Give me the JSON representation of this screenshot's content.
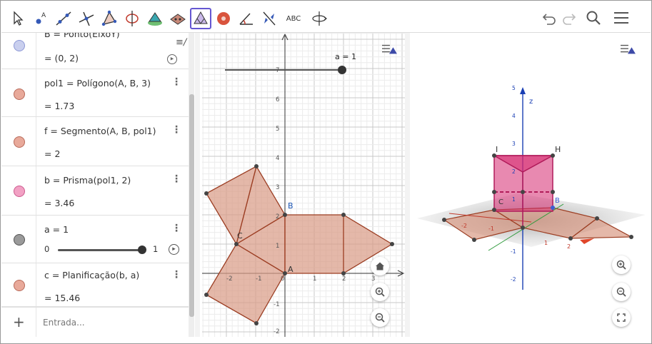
{
  "algebra": {
    "items": [
      {
        "def": "B = Ponto(EixoY)",
        "value": "= (0, 2)",
        "color": "#c9cfee",
        "border": "#8d98d6"
      },
      {
        "def": "pol1 = Polígono(A, B, 3)",
        "value": "= 1.73",
        "color": "#e8a99a",
        "border": "#b86a5a"
      },
      {
        "def": "f = Segmento(A, B, pol1)",
        "value": "= 2",
        "color": "#e8a99a",
        "border": "#b86a5a"
      },
      {
        "def": "b = Prisma(pol1, 2)",
        "value": "= 3.46",
        "color": "#f2a1c4",
        "border": "#cc5b8f"
      },
      {
        "def": "a = 1",
        "slider_min": "0",
        "slider_max": "1",
        "slider_level": 1.0,
        "color": "#9a9a9a",
        "border": "#555"
      },
      {
        "def": "c = Planificação(b, a)",
        "value": "= 15.46",
        "color": "#e8a99a",
        "border": "#b86a5a"
      }
    ],
    "input_placeholder": "Entrada..."
  },
  "graphics2d": {
    "slider_label": "a = 1",
    "slider_level": 1.0,
    "x_ticks": [
      "-2",
      "-1",
      "0",
      "1",
      "2",
      "3"
    ],
    "y_ticks": [
      "7",
      "6",
      "5",
      "4",
      "3",
      "2",
      "1",
      "-1",
      "-2"
    ],
    "point_labels": [
      "A",
      "B",
      "C"
    ]
  },
  "graphics3d": {
    "z_ticks": [
      "5",
      "4",
      "3",
      "2",
      "1",
      "-1",
      "-2"
    ],
    "axis_label": "z",
    "point_labels": [
      "I",
      "H",
      "B",
      "C"
    ],
    "plane_ticks": [
      "-2",
      "-1",
      "1",
      "2"
    ]
  },
  "colors": {
    "accent": "#6557d2",
    "polygon_fill": "#d99a84",
    "polygon_stroke": "#9b3d22",
    "prism": "#d6286f",
    "point": "#444444"
  },
  "icons": [
    "move-icon",
    "point-icon",
    "line-icon",
    "perpendicular-icon",
    "polygon-icon",
    "circle-axis-icon",
    "pyramid-icon",
    "intersect-icon",
    "net-icon",
    "sphere-icon",
    "angle-icon",
    "reflect-icon",
    "text-icon",
    "rotate-view-icon",
    "undo-icon",
    "redo-icon",
    "search-icon",
    "menu-icon"
  ],
  "labels": {
    "text_tool": "ABC"
  }
}
